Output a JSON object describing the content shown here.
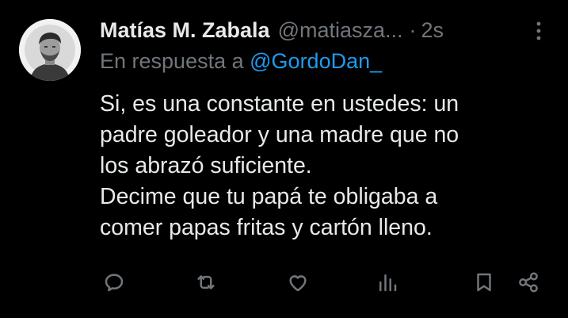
{
  "tweet": {
    "author_name": "Matías M. Zabala",
    "author_handle": "@matiasza...",
    "separator": "·",
    "timestamp": "2s",
    "reply_prefix": "En respuesta a",
    "reply_to_handle": "@GordoDan_",
    "body_lines": [
      "Si, es una constante en ustedes: un",
      "padre goleador y una madre que no",
      "los abrazó suficiente.",
      "Decime que tu papá te obligaba a",
      "comer papas fritas y cartón lleno."
    ]
  },
  "actions": {
    "icons": [
      "reply-icon",
      "retweet-icon",
      "like-icon",
      "views-icon",
      "bookmark-icon",
      "share-icon"
    ]
  },
  "colors": {
    "background": "#000000",
    "primary_text": "#e7e9ea",
    "secondary_text": "#71767b",
    "link": "#1d9bf0"
  }
}
